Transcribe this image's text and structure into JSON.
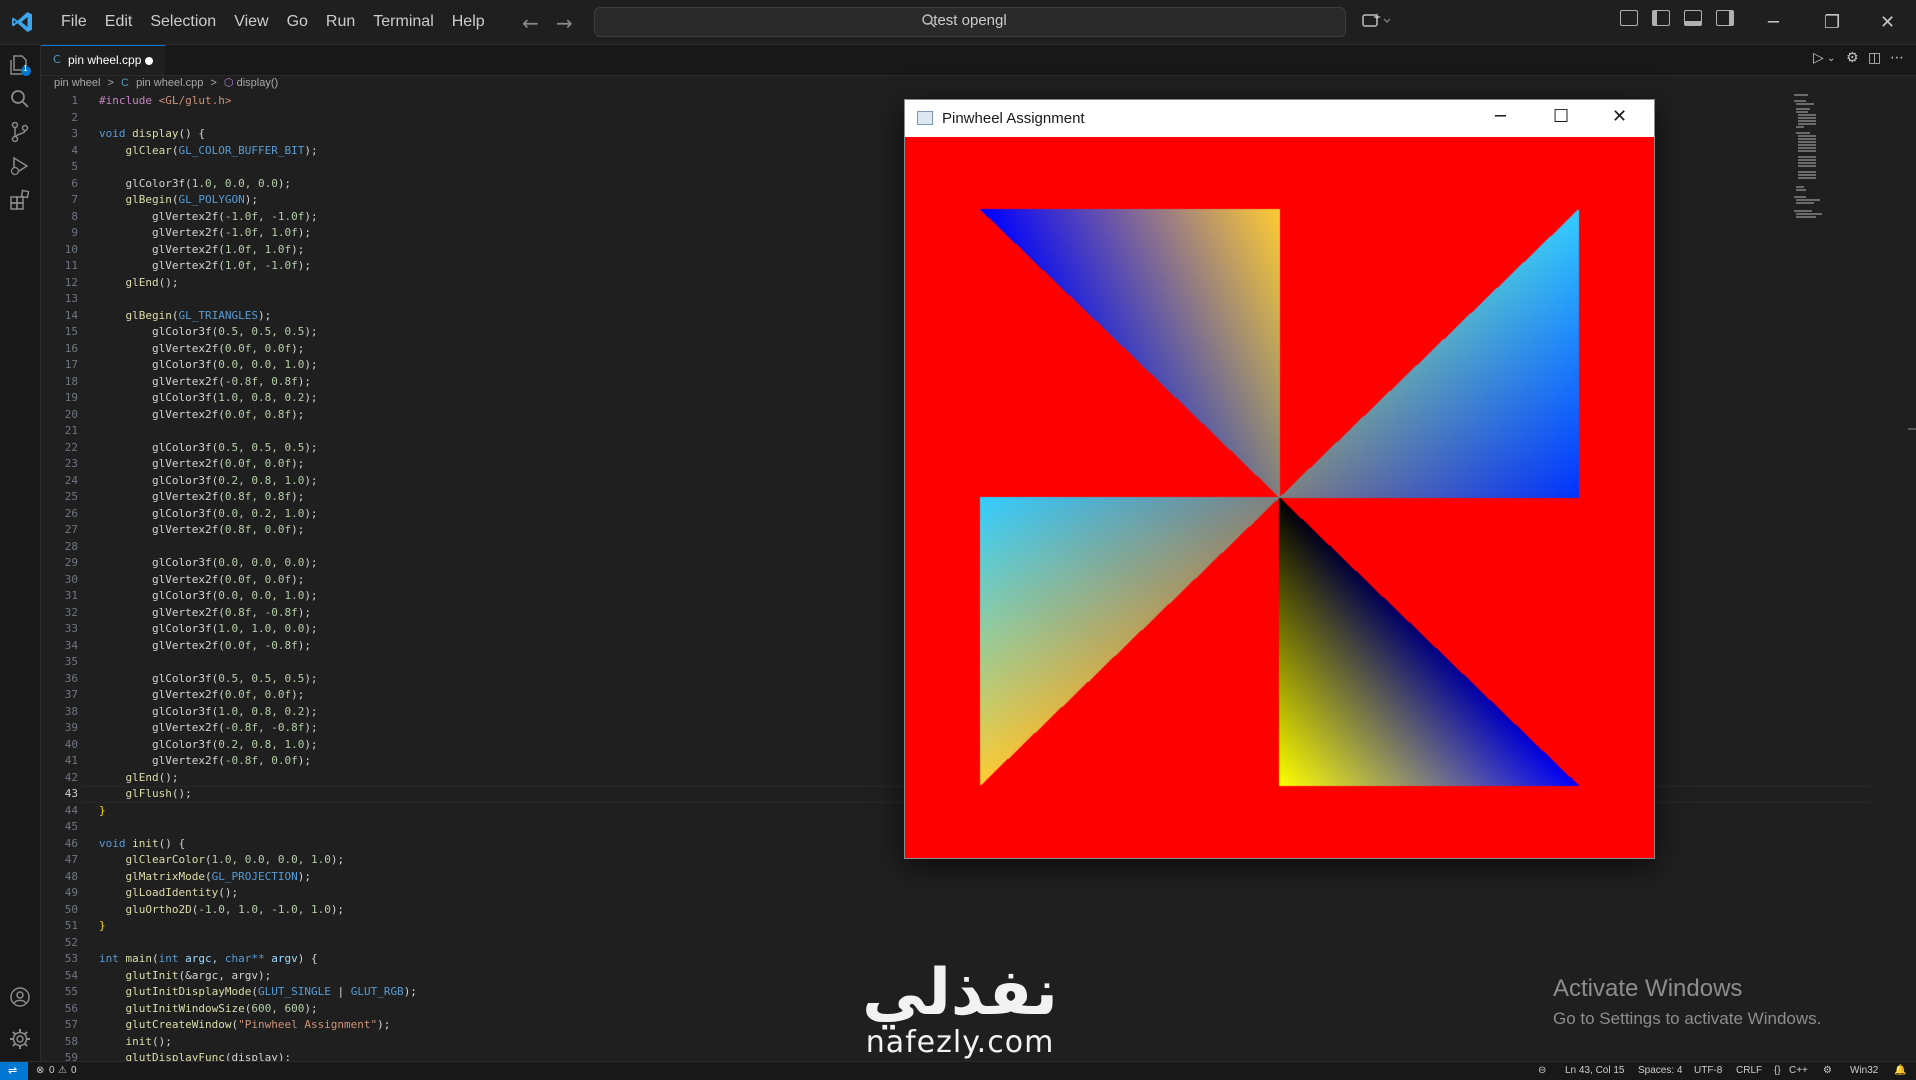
{
  "menu": [
    "File",
    "Edit",
    "Selection",
    "View",
    "Go",
    "Run",
    "Terminal",
    "Help"
  ],
  "search": {
    "text": "test opengl"
  },
  "tab": {
    "icon": "C",
    "name": "pin wheel.cpp"
  },
  "breadcrumb": {
    "folder": "pin wheel",
    "file": "pin wheel.cpp",
    "symbol": "display()",
    "sep": ">"
  },
  "explorer_badge": "1",
  "current_line": 43,
  "code_lines": [
    [
      {
        "t": "#include ",
        "c": "#c586c0"
      },
      {
        "t": "<GL/glut.h>",
        "c": "#ce9178"
      }
    ],
    [],
    [
      {
        "t": "void ",
        "c": "#569cd6"
      },
      {
        "t": "display",
        "c": "#dcdcaa"
      },
      {
        "t": "() {",
        "c": "#d4d4d4"
      }
    ],
    [
      {
        "t": "    ",
        "c": "#d4d4d4"
      },
      {
        "t": "glClear",
        "c": "#dcdcaa"
      },
      {
        "t": "(",
        "c": "#d4d4d4"
      },
      {
        "t": "GL_COLOR_BUFFER_BIT",
        "c": "#569cd6"
      },
      {
        "t": ");",
        "c": "#d4d4d4"
      }
    ],
    [],
    [
      {
        "t": "    glColor3f(",
        "c": "#d4d4d4"
      },
      {
        "t": "1.0, 0.0, 0.0",
        "c": "#b5cea8"
      },
      {
        "t": ");",
        "c": "#d4d4d4"
      }
    ],
    [
      {
        "t": "    ",
        "c": "#d4d4d4"
      },
      {
        "t": "glBegin",
        "c": "#dcdcaa"
      },
      {
        "t": "(",
        "c": "#d4d4d4"
      },
      {
        "t": "GL_POLYGON",
        "c": "#569cd6"
      },
      {
        "t": ");",
        "c": "#d4d4d4"
      }
    ],
    [
      {
        "t": "        glVertex2f(",
        "c": "#d4d4d4"
      },
      {
        "t": "-1.0f, -1.0f",
        "c": "#b5cea8"
      },
      {
        "t": ");",
        "c": "#d4d4d4"
      }
    ],
    [
      {
        "t": "        glVertex2f(",
        "c": "#d4d4d4"
      },
      {
        "t": "-1.0f, 1.0f",
        "c": "#b5cea8"
      },
      {
        "t": ");",
        "c": "#d4d4d4"
      }
    ],
    [
      {
        "t": "        glVertex2f(",
        "c": "#d4d4d4"
      },
      {
        "t": "1.0f, 1.0f",
        "c": "#b5cea8"
      },
      {
        "t": ");",
        "c": "#d4d4d4"
      }
    ],
    [
      {
        "t": "        glVertex2f(",
        "c": "#d4d4d4"
      },
      {
        "t": "1.0f, -1.0f",
        "c": "#b5cea8"
      },
      {
        "t": ");",
        "c": "#d4d4d4"
      }
    ],
    [
      {
        "t": "    ",
        "c": "#d4d4d4"
      },
      {
        "t": "glEnd",
        "c": "#dcdcaa"
      },
      {
        "t": "();",
        "c": "#d4d4d4"
      }
    ],
    [],
    [
      {
        "t": "    ",
        "c": "#d4d4d4"
      },
      {
        "t": "glBegin",
        "c": "#dcdcaa"
      },
      {
        "t": "(",
        "c": "#d4d4d4"
      },
      {
        "t": "GL_TRIANGLES",
        "c": "#569cd6"
      },
      {
        "t": ");",
        "c": "#d4d4d4"
      }
    ],
    [
      {
        "t": "        glColor3f(",
        "c": "#d4d4d4"
      },
      {
        "t": "0.5, 0.5, 0.5",
        "c": "#b5cea8"
      },
      {
        "t": ");",
        "c": "#d4d4d4"
      }
    ],
    [
      {
        "t": "        glVertex2f(",
        "c": "#d4d4d4"
      },
      {
        "t": "0.0f, 0.0f",
        "c": "#b5cea8"
      },
      {
        "t": ");",
        "c": "#d4d4d4"
      }
    ],
    [
      {
        "t": "        glColor3f(",
        "c": "#d4d4d4"
      },
      {
        "t": "0.0, 0.0, 1.0",
        "c": "#b5cea8"
      },
      {
        "t": ");",
        "c": "#d4d4d4"
      }
    ],
    [
      {
        "t": "        glVertex2f(",
        "c": "#d4d4d4"
      },
      {
        "t": "-0.8f, 0.8f",
        "c": "#b5cea8"
      },
      {
        "t": ");",
        "c": "#d4d4d4"
      }
    ],
    [
      {
        "t": "        glColor3f(",
        "c": "#d4d4d4"
      },
      {
        "t": "1.0, 0.8, 0.2",
        "c": "#b5cea8"
      },
      {
        "t": ");",
        "c": "#d4d4d4"
      }
    ],
    [
      {
        "t": "        glVertex2f(",
        "c": "#d4d4d4"
      },
      {
        "t": "0.0f, 0.8f",
        "c": "#b5cea8"
      },
      {
        "t": ");",
        "c": "#d4d4d4"
      }
    ],
    [],
    [
      {
        "t": "        glColor3f(",
        "c": "#d4d4d4"
      },
      {
        "t": "0.5, 0.5, 0.5",
        "c": "#b5cea8"
      },
      {
        "t": ");",
        "c": "#d4d4d4"
      }
    ],
    [
      {
        "t": "        glVertex2f(",
        "c": "#d4d4d4"
      },
      {
        "t": "0.0f, 0.0f",
        "c": "#b5cea8"
      },
      {
        "t": ");",
        "c": "#d4d4d4"
      }
    ],
    [
      {
        "t": "        glColor3f(",
        "c": "#d4d4d4"
      },
      {
        "t": "0.2, 0.8, 1.0",
        "c": "#b5cea8"
      },
      {
        "t": ");",
        "c": "#d4d4d4"
      }
    ],
    [
      {
        "t": "        glVertex2f(",
        "c": "#d4d4d4"
      },
      {
        "t": "0.8f, 0.8f",
        "c": "#b5cea8"
      },
      {
        "t": ");",
        "c": "#d4d4d4"
      }
    ],
    [
      {
        "t": "        glColor3f(",
        "c": "#d4d4d4"
      },
      {
        "t": "0.0, 0.2, 1.0",
        "c": "#b5cea8"
      },
      {
        "t": ");",
        "c": "#d4d4d4"
      }
    ],
    [
      {
        "t": "        glVertex2f(",
        "c": "#d4d4d4"
      },
      {
        "t": "0.8f, 0.0f",
        "c": "#b5cea8"
      },
      {
        "t": ");",
        "c": "#d4d4d4"
      }
    ],
    [],
    [
      {
        "t": "        glColor3f(",
        "c": "#d4d4d4"
      },
      {
        "t": "0.0, 0.0, 0.0",
        "c": "#b5cea8"
      },
      {
        "t": ");",
        "c": "#d4d4d4"
      }
    ],
    [
      {
        "t": "        glVertex2f(",
        "c": "#d4d4d4"
      },
      {
        "t": "0.0f, 0.0f",
        "c": "#b5cea8"
      },
      {
        "t": ");",
        "c": "#d4d4d4"
      }
    ],
    [
      {
        "t": "        glColor3f(",
        "c": "#d4d4d4"
      },
      {
        "t": "0.0, 0.0, 1.0",
        "c": "#b5cea8"
      },
      {
        "t": ");",
        "c": "#d4d4d4"
      }
    ],
    [
      {
        "t": "        glVertex2f(",
        "c": "#d4d4d4"
      },
      {
        "t": "0.8f, -0.8f",
        "c": "#b5cea8"
      },
      {
        "t": ");",
        "c": "#d4d4d4"
      }
    ],
    [
      {
        "t": "        glColor3f(",
        "c": "#d4d4d4"
      },
      {
        "t": "1.0, 1.0, 0.0",
        "c": "#b5cea8"
      },
      {
        "t": ");",
        "c": "#d4d4d4"
      }
    ],
    [
      {
        "t": "        glVertex2f(",
        "c": "#d4d4d4"
      },
      {
        "t": "0.0f, -0.8f",
        "c": "#b5cea8"
      },
      {
        "t": ");",
        "c": "#d4d4d4"
      }
    ],
    [],
    [
      {
        "t": "        glColor3f(",
        "c": "#d4d4d4"
      },
      {
        "t": "0.5, 0.5, 0.5",
        "c": "#b5cea8"
      },
      {
        "t": ");",
        "c": "#d4d4d4"
      }
    ],
    [
      {
        "t": "        glVertex2f(",
        "c": "#d4d4d4"
      },
      {
        "t": "0.0f, 0.0f",
        "c": "#b5cea8"
      },
      {
        "t": ");",
        "c": "#d4d4d4"
      }
    ],
    [
      {
        "t": "        glColor3f(",
        "c": "#d4d4d4"
      },
      {
        "t": "1.0, 0.8, 0.2",
        "c": "#b5cea8"
      },
      {
        "t": ");",
        "c": "#d4d4d4"
      }
    ],
    [
      {
        "t": "        glVertex2f(",
        "c": "#d4d4d4"
      },
      {
        "t": "-0.8f, -0.8f",
        "c": "#b5cea8"
      },
      {
        "t": ");",
        "c": "#d4d4d4"
      }
    ],
    [
      {
        "t": "        glColor3f(",
        "c": "#d4d4d4"
      },
      {
        "t": "0.2, 0.8, 1.0",
        "c": "#b5cea8"
      },
      {
        "t": ");",
        "c": "#d4d4d4"
      }
    ],
    [
      {
        "t": "        glVertex2f(",
        "c": "#d4d4d4"
      },
      {
        "t": "-0.8f, 0.0f",
        "c": "#b5cea8"
      },
      {
        "t": ");",
        "c": "#d4d4d4"
      }
    ],
    [
      {
        "t": "    ",
        "c": "#d4d4d4"
      },
      {
        "t": "glEnd",
        "c": "#dcdcaa"
      },
      {
        "t": "();",
        "c": "#d4d4d4"
      }
    ],
    [
      {
        "t": "    ",
        "c": "#d4d4d4"
      },
      {
        "t": "glFlush",
        "c": "#dcdcaa"
      },
      {
        "t": "();",
        "c": "#d4d4d4"
      }
    ],
    [
      {
        "t": "}",
        "c": "#ffd700"
      }
    ],
    [],
    [
      {
        "t": "void ",
        "c": "#569cd6"
      },
      {
        "t": "init",
        "c": "#dcdcaa"
      },
      {
        "t": "() {",
        "c": "#d4d4d4"
      }
    ],
    [
      {
        "t": "    ",
        "c": "#d4d4d4"
      },
      {
        "t": "glClearColor",
        "c": "#dcdcaa"
      },
      {
        "t": "(",
        "c": "#d4d4d4"
      },
      {
        "t": "1.0, 0.0, 0.0, 1.0",
        "c": "#b5cea8"
      },
      {
        "t": ");",
        "c": "#d4d4d4"
      }
    ],
    [
      {
        "t": "    ",
        "c": "#d4d4d4"
      },
      {
        "t": "glMatrixMode",
        "c": "#dcdcaa"
      },
      {
        "t": "(",
        "c": "#d4d4d4"
      },
      {
        "t": "GL_PROJECTION",
        "c": "#569cd6"
      },
      {
        "t": ");",
        "c": "#d4d4d4"
      }
    ],
    [
      {
        "t": "    ",
        "c": "#d4d4d4"
      },
      {
        "t": "glLoadIdentity",
        "c": "#dcdcaa"
      },
      {
        "t": "();",
        "c": "#d4d4d4"
      }
    ],
    [
      {
        "t": "    ",
        "c": "#d4d4d4"
      },
      {
        "t": "gluOrtho2D",
        "c": "#dcdcaa"
      },
      {
        "t": "(",
        "c": "#d4d4d4"
      },
      {
        "t": "-1.0, 1.0, -1.0, 1.0",
        "c": "#b5cea8"
      },
      {
        "t": ");",
        "c": "#d4d4d4"
      }
    ],
    [
      {
        "t": "}",
        "c": "#ffd700"
      }
    ],
    [],
    [
      {
        "t": "int ",
        "c": "#569cd6"
      },
      {
        "t": "main",
        "c": "#dcdcaa"
      },
      {
        "t": "(",
        "c": "#d4d4d4"
      },
      {
        "t": "int ",
        "c": "#569cd6"
      },
      {
        "t": "argc, ",
        "c": "#9cdcfe"
      },
      {
        "t": "char** ",
        "c": "#569cd6"
      },
      {
        "t": "argv",
        "c": "#9cdcfe"
      },
      {
        "t": ") {",
        "c": "#d4d4d4"
      }
    ],
    [
      {
        "t": "    ",
        "c": "#d4d4d4"
      },
      {
        "t": "glutInit",
        "c": "#dcdcaa"
      },
      {
        "t": "(&argc, argv);",
        "c": "#d4d4d4"
      }
    ],
    [
      {
        "t": "    ",
        "c": "#d4d4d4"
      },
      {
        "t": "glutInitDisplayMode",
        "c": "#dcdcaa"
      },
      {
        "t": "(",
        "c": "#d4d4d4"
      },
      {
        "t": "GLUT_SINGLE",
        "c": "#569cd6"
      },
      {
        "t": " | ",
        "c": "#d4d4d4"
      },
      {
        "t": "GLUT_RGB",
        "c": "#569cd6"
      },
      {
        "t": ");",
        "c": "#d4d4d4"
      }
    ],
    [
      {
        "t": "    ",
        "c": "#d4d4d4"
      },
      {
        "t": "glutInitWindowSize",
        "c": "#dcdcaa"
      },
      {
        "t": "(",
        "c": "#d4d4d4"
      },
      {
        "t": "600, 600",
        "c": "#b5cea8"
      },
      {
        "t": ");",
        "c": "#d4d4d4"
      }
    ],
    [
      {
        "t": "    ",
        "c": "#d4d4d4"
      },
      {
        "t": "glutCreateWindow",
        "c": "#dcdcaa"
      },
      {
        "t": "(",
        "c": "#d4d4d4"
      },
      {
        "t": "\"Pinwheel Assignment\"",
        "c": "#ce9178"
      },
      {
        "t": ");",
        "c": "#d4d4d4"
      }
    ],
    [
      {
        "t": "    ",
        "c": "#d4d4d4"
      },
      {
        "t": "init",
        "c": "#dcdcaa"
      },
      {
        "t": "();",
        "c": "#d4d4d4"
      }
    ],
    [
      {
        "t": "    ",
        "c": "#d4d4d4"
      },
      {
        "t": "glutDisplayFunc",
        "c": "#dcdcaa"
      },
      {
        "t": "(display);",
        "c": "#d4d4d4"
      }
    ]
  ],
  "gl_window": {
    "title": "Pinwheel Assignment"
  },
  "pinwheel": {
    "background": [
      1.0,
      0.0,
      0.0
    ],
    "triangles": [
      {
        "v": [
          [
            0.0,
            0.0
          ],
          [
            -0.8,
            0.8
          ],
          [
            0.0,
            0.8
          ]
        ],
        "c": [
          [
            0.5,
            0.5,
            0.5
          ],
          [
            0.0,
            0.0,
            1.0
          ],
          [
            1.0,
            0.8,
            0.2
          ]
        ]
      },
      {
        "v": [
          [
            0.0,
            0.0
          ],
          [
            0.8,
            0.8
          ],
          [
            0.8,
            0.0
          ]
        ],
        "c": [
          [
            0.5,
            0.5,
            0.5
          ],
          [
            0.2,
            0.8,
            1.0
          ],
          [
            0.0,
            0.2,
            1.0
          ]
        ]
      },
      {
        "v": [
          [
            0.0,
            0.0
          ],
          [
            0.8,
            -0.8
          ],
          [
            0.0,
            -0.8
          ]
        ],
        "c": [
          [
            0.0,
            0.0,
            0.0
          ],
          [
            0.0,
            0.0,
            1.0
          ],
          [
            1.0,
            1.0,
            0.0
          ]
        ]
      },
      {
        "v": [
          [
            0.0,
            0.0
          ],
          [
            -0.8,
            -0.8
          ],
          [
            -0.8,
            0.0
          ]
        ],
        "c": [
          [
            0.5,
            0.5,
            0.5
          ],
          [
            1.0,
            0.8,
            0.2
          ],
          [
            0.2,
            0.8,
            1.0
          ]
        ]
      }
    ]
  },
  "status": {
    "errors": "0",
    "warnings": "0",
    "position": "Ln 43, Col 15",
    "spaces": "Spaces: 4",
    "encoding": "UTF-8",
    "eol": "CRLF",
    "language": "C++",
    "platform": "Win32"
  },
  "activate": {
    "title": "Activate Windows",
    "subtitle": "Go to Settings to activate Windows."
  },
  "watermark": {
    "arabic": "نفذلي",
    "latin": "nafezly.com"
  },
  "colors": {
    "accent": "#0078d4",
    "editor_bg": "#1f1f1f",
    "sidebar_bg": "#181818"
  }
}
